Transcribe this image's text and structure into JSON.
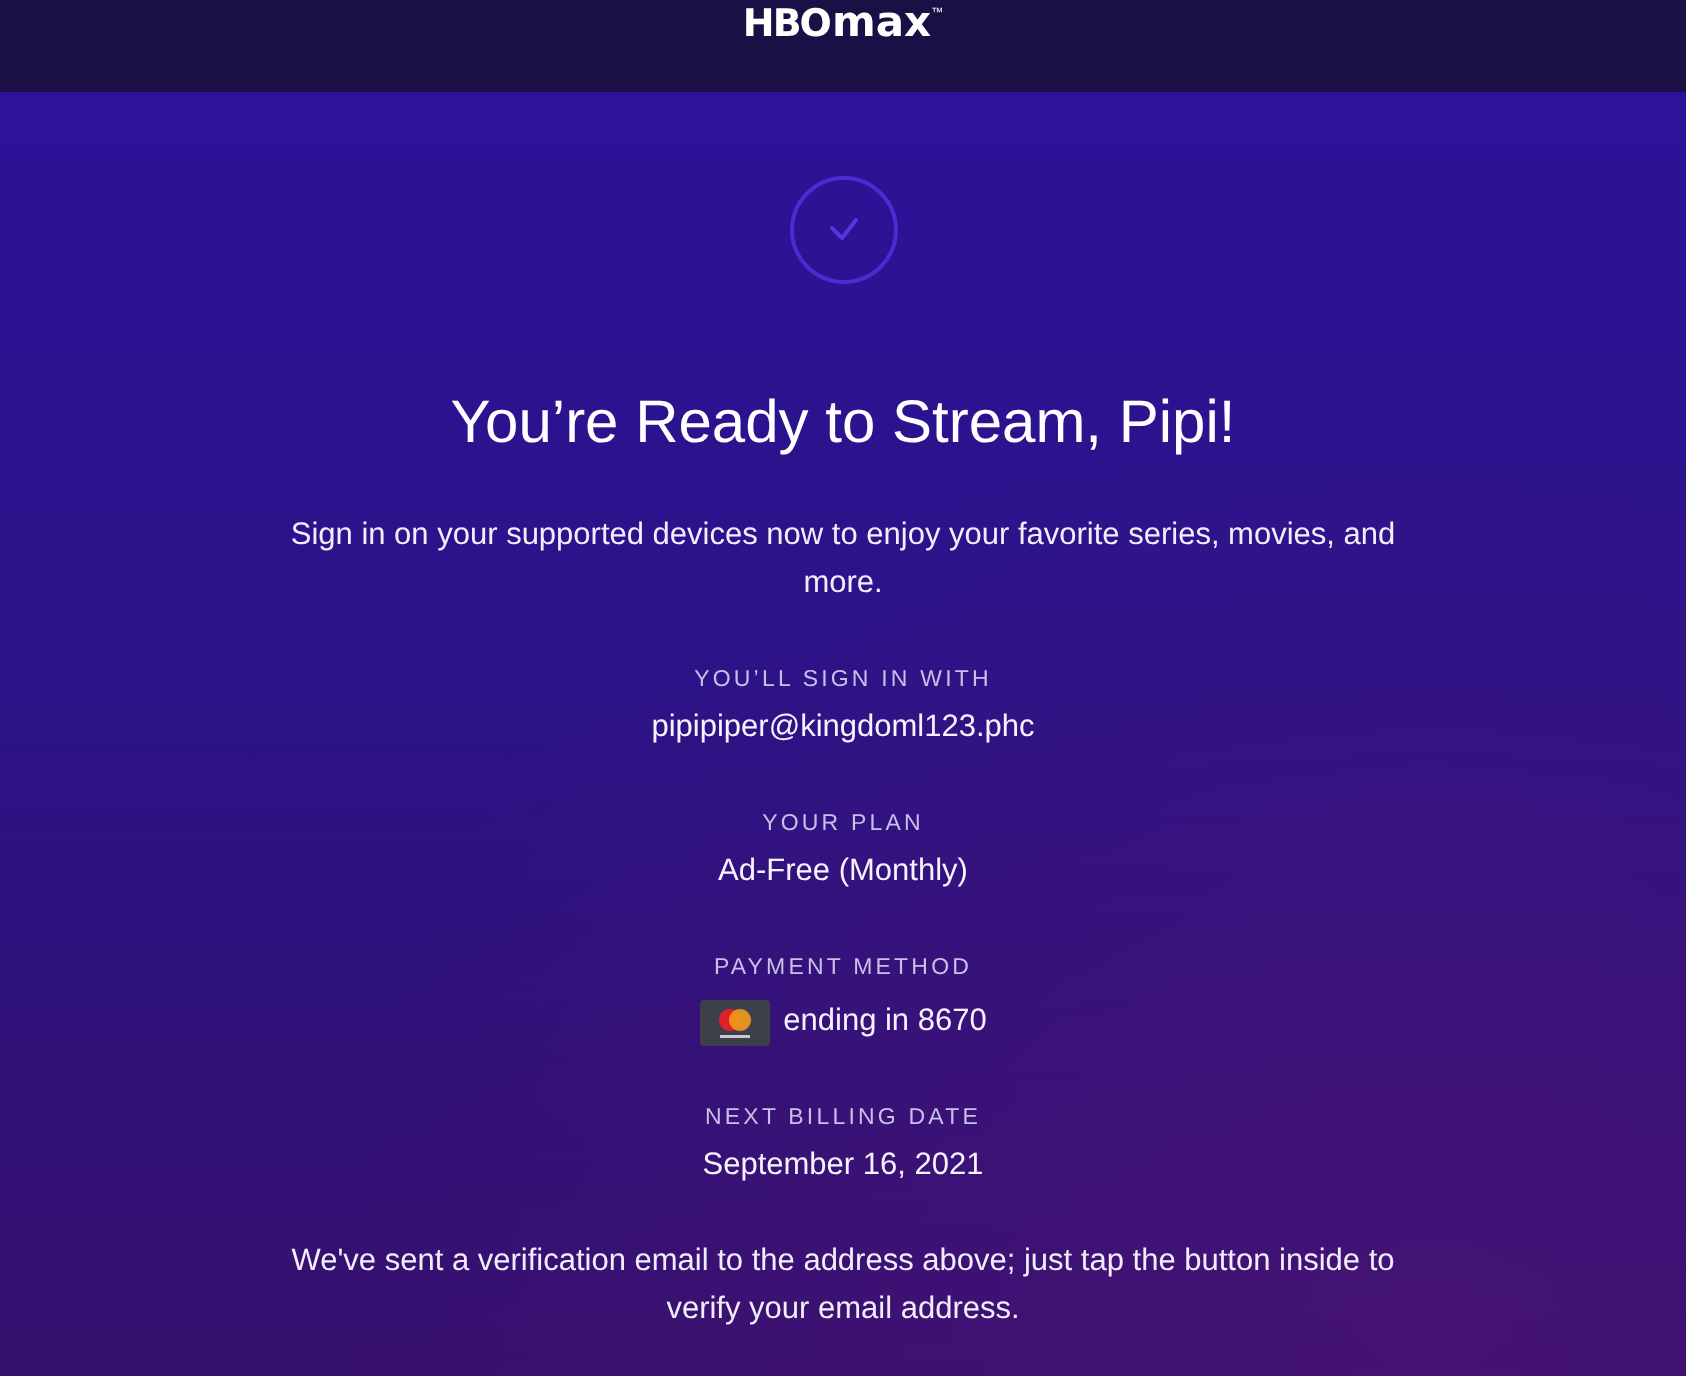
{
  "header": {
    "logo": {
      "primary": "HBO",
      "secondary": "max",
      "trademark": "™"
    }
  },
  "confirmation": {
    "title": "You’re Ready to Stream, Pipi!",
    "intro": "Sign in on your supported devices now to enjoy your favorite series, movies, and more.",
    "details": [
      {
        "kind": "text",
        "label": "YOU’LL SIGN IN WITH",
        "value": "pipipiper@kingdoml123.phc"
      },
      {
        "kind": "text",
        "label": "YOUR PLAN",
        "value": "Ad-Free (Monthly)"
      },
      {
        "kind": "card",
        "label": "PAYMENT METHOD",
        "value": "ending in 8670"
      },
      {
        "kind": "text",
        "label": "NEXT BILLING DATE",
        "value": "September 16, 2021"
      }
    ],
    "note": "We've sent a verification email to the address above; just tap the button inside to verify your email address."
  }
}
